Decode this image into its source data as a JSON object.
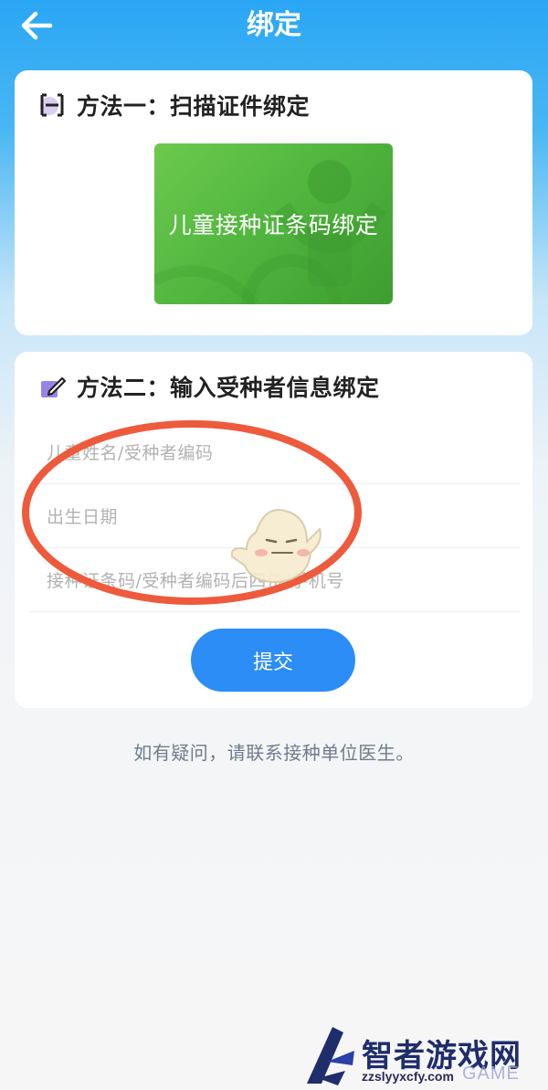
{
  "header": {
    "title": "绑定"
  },
  "method1": {
    "title": "方法一：扫描证件绑定",
    "card_label": "儿童接种证条码绑定"
  },
  "method2": {
    "title": "方法二：输入受种者信息绑定",
    "fields": [
      {
        "placeholder": "儿童姓名/受种者编码"
      },
      {
        "placeholder": "出生日期"
      },
      {
        "placeholder": "接种证条码/受种者编码后四位/手机号"
      }
    ],
    "submit_label": "提交"
  },
  "footer": {
    "help": "如有疑问，请联系接种单位医生。"
  },
  "watermark": {
    "brand": "智者游戏网",
    "url": "zzslyyxcfy.com",
    "game": "GAME"
  },
  "colors": {
    "accent": "#2b8df5",
    "header": "#2aa6f5",
    "scan_card": "#4db33c",
    "annotation": "#ee5a3c"
  }
}
